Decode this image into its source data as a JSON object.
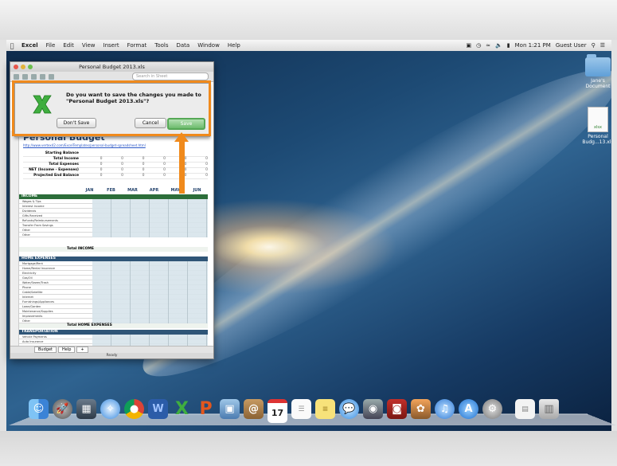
{
  "menubar": {
    "app": "Excel",
    "items": [
      "File",
      "Edit",
      "View",
      "Insert",
      "Format",
      "Tools",
      "Data",
      "Window",
      "Help"
    ],
    "clock": "Mon 1:21 PM",
    "user": "Guest User"
  },
  "desktop_icons": [
    {
      "label": "Jane's Document",
      "icon": "folder-icon"
    },
    {
      "label": "Personal Budg...13.xls",
      "icon": "excel-document-icon"
    }
  ],
  "window": {
    "title": "Personal Budget 2013.xls",
    "search_placeholder": "Search in Sheet"
  },
  "sheet": {
    "title": "Personal Budget",
    "link": "http://www.vertex42.com/ExcelTemplates/personal-budget-spreadsheet.html",
    "summary_rows": [
      {
        "label": "Starting Balance",
        "values": [
          "",
          "",
          "",
          "",
          "",
          ""
        ]
      },
      {
        "label": "Total Income",
        "values": [
          "0",
          "0",
          "0",
          "0",
          "0",
          "0"
        ]
      },
      {
        "label": "Total Expenses",
        "values": [
          "0",
          "0",
          "0",
          "0",
          "0",
          "0"
        ]
      },
      {
        "label": "NET (Income - Expenses)",
        "values": [
          "0",
          "0",
          "0",
          "0",
          "0",
          "0"
        ]
      },
      {
        "label": "Projected End Balance",
        "values": [
          "0",
          "0",
          "0",
          "0",
          "0",
          "0"
        ]
      }
    ],
    "months": [
      "JAN",
      "FEB",
      "MAR",
      "APR",
      "MAY",
      "JUN"
    ],
    "income_band": "INCOME",
    "income_labels": [
      "Wages & Tips",
      "Interest Income",
      "Dividends",
      "Gifts Received",
      "Refunds/Reimbursements",
      "Transfer From Savings",
      "Other",
      "Other"
    ],
    "income_total": "Total INCOME",
    "home_band": "HOME EXPENSES",
    "home_labels": [
      "Mortgage/Rent",
      "Home/Rental Insurance",
      "Electricity",
      "Gas/Oil",
      "Water/Sewer/Trash",
      "Phone",
      "Cable/Satellite",
      "Internet",
      "Furnishings/Appliances",
      "Lawn/Garden",
      "Maintenance/Supplies",
      "Improvements",
      "Other"
    ],
    "home_total": "Total HOME EXPENSES",
    "trans_band": "TRANSPORTATION",
    "trans_labels": [
      "Vehicle Payments",
      "Auto Insurance"
    ],
    "tabs": [
      "Budget",
      "Help"
    ],
    "tab_plus": "+",
    "status": "Ready"
  },
  "dialog": {
    "message": "Do you want to save the changes you made to \"Personal Budget 2013.xls\"?",
    "dont_save": "Don't Save",
    "cancel": "Cancel",
    "save": "Save",
    "highlight_color": "#f08a1c"
  },
  "dock": {
    "icons": [
      "finder-icon",
      "launchpad-icon",
      "mission-control-icon",
      "safari-icon",
      "chrome-icon",
      "word-icon",
      "excel-icon",
      "powerpoint-icon",
      "preview-icon",
      "contacts-icon",
      "calendar-icon",
      "reminders-icon",
      "notes-icon",
      "messages-icon",
      "facetime-icon",
      "photo-booth-icon",
      "iphoto-icon",
      "itunes-icon",
      "app-store-icon",
      "system-preferences-icon",
      "documents-icon",
      "trash-icon"
    ],
    "calendar_day": "17",
    "word_letter": "W",
    "excel_letter": "X",
    "powerpoint_letter": "P"
  }
}
